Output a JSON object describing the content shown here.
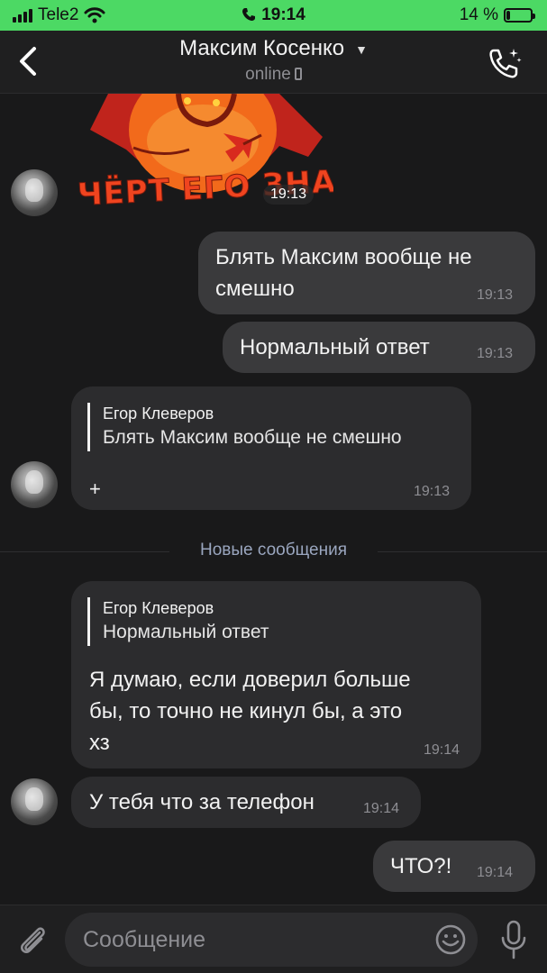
{
  "status_bar": {
    "carrier": "Tele2",
    "time": "19:14",
    "battery": "14 %",
    "battery_level": 0.14
  },
  "header": {
    "back_icon": "chevron-left-icon",
    "contact_name": "Максим Косенко",
    "status": "online",
    "call_icon": "phone-call-icon"
  },
  "chat": {
    "sticker": {
      "caption": "ЧЁРТ ЕГО ЗНАЕТ",
      "time": "19:13"
    },
    "messages": [
      {
        "direction": "out",
        "text_lines": [
          "Блять Максим вообще не",
          "смешно"
        ],
        "time": "19:13"
      },
      {
        "direction": "out",
        "text": "Нормальный ответ",
        "time": "19:13"
      },
      {
        "direction": "in",
        "reply_name": "Егор Клеверов",
        "reply_text": "Блять Максим вообще не смешно",
        "text": "+",
        "time": "19:13"
      },
      {
        "direction": "in",
        "reply_name": "Егор Клеверов",
        "reply_text": "Нормальный ответ",
        "text_lines": [
          "Я думаю, если доверил больше",
          "бы, то точно не кинул бы, а это",
          "хз"
        ],
        "time": "19:14"
      },
      {
        "direction": "in",
        "text": "У тебя что за телефон",
        "time": "19:14"
      },
      {
        "direction": "out",
        "text": "ЧТО?!",
        "time": "19:14"
      }
    ],
    "new_messages_label": "Новые сообщения"
  },
  "input_bar": {
    "placeholder": "Сообщение",
    "attach_icon": "paperclip-icon",
    "emoji_icon": "emoji-icon",
    "mic_icon": "microphone-icon"
  },
  "colors": {
    "status_bar": "#4cd964",
    "background": "#19191a",
    "bubble_in": "#2c2c2e",
    "bubble_out": "#3a3a3c",
    "divider_text": "#9aa6bf"
  }
}
